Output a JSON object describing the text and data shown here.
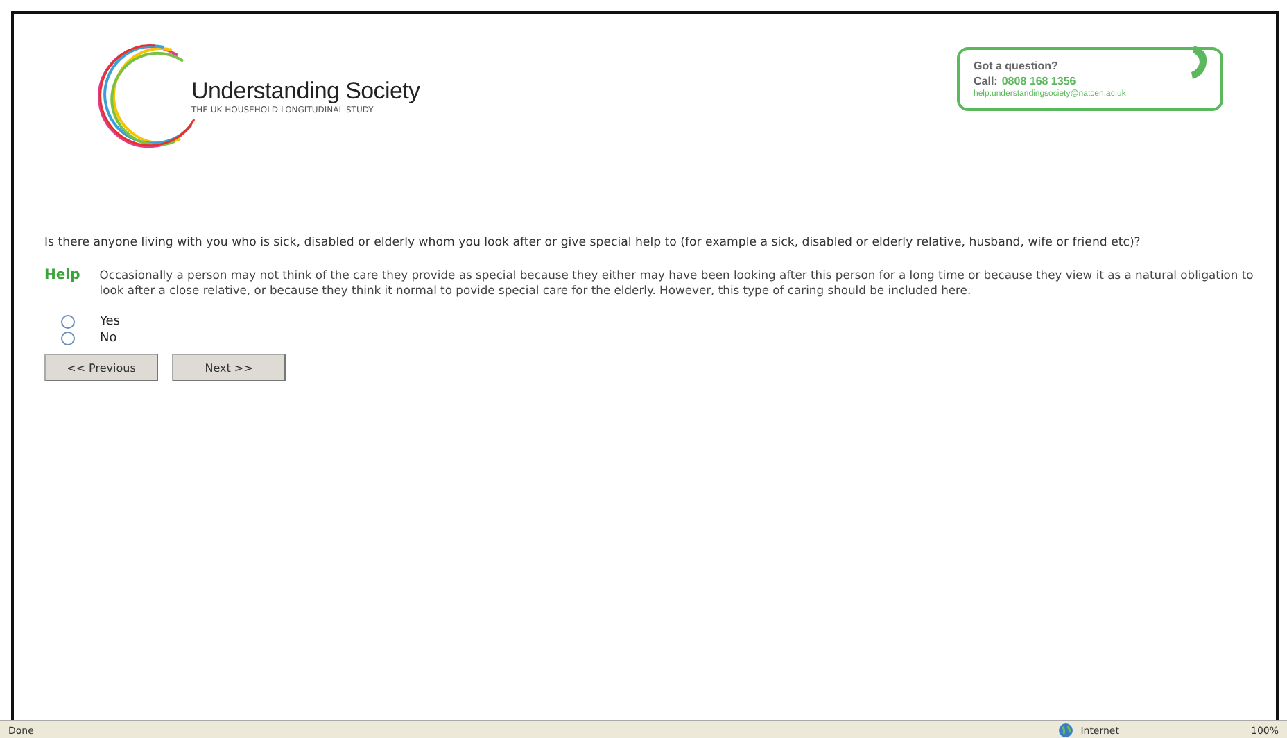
{
  "logo": {
    "title": "Understanding Society",
    "subtitle": "THE UK HOUSEHOLD LONGITUDINAL STUDY"
  },
  "contact": {
    "heading": "Got a question?",
    "call_label": "Call:",
    "phone": "0808 168 1356",
    "email": "help.understandingsociety@natcen.ac.uk"
  },
  "question": "Is there anyone living with you who is sick, disabled or elderly whom you look after or give special help to (for example a sick, disabled or elderly relative, husband, wife or friend etc)?",
  "help": {
    "label": "Help",
    "text": "Occasionally a person may not think of the care they provide as special because they either may have been looking after this person for a long time or because they view it as a natural obligation to look after a close relative, or because they think it normal to povide special care for the elderly. However, this type of caring should be included here."
  },
  "options": [
    {
      "label": "Yes",
      "selected": false
    },
    {
      "label": "No",
      "selected": false
    }
  ],
  "buttons": [
    "<< Previous",
    "Next >>"
  ],
  "status_bar": {
    "status": "Done",
    "zone": "Internet",
    "zoom": "100%"
  }
}
